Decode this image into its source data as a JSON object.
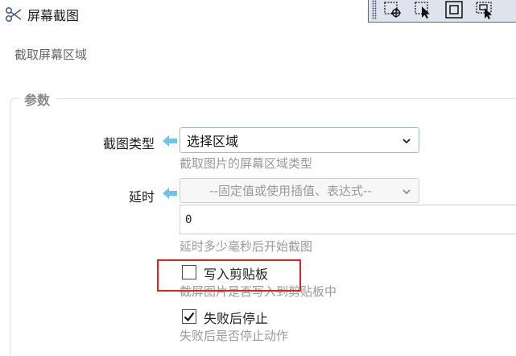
{
  "title": {
    "text": "屏幕截图",
    "icon": "scissors-icon"
  },
  "toolbar": {
    "buttons": [
      {
        "icon": "capture-region-icon"
      },
      {
        "icon": "select-pointer-icon"
      },
      {
        "icon": "capture-window-icon"
      },
      {
        "icon": "capture-element-icon"
      }
    ]
  },
  "subtitle": "截取屏幕区域",
  "section": {
    "title": "参数"
  },
  "params": {
    "capture_type": {
      "label": "截图类型",
      "value": "选择区域",
      "hint": "截取图片的屏幕区域类型"
    },
    "delay": {
      "label": "延时",
      "placeholder": "--固定值或使用插值、表达式--",
      "value": "0",
      "hint": "延时多少毫秒后开始截图"
    },
    "write_clipboard": {
      "label": "写入剪贴板",
      "checked": false,
      "hint": "截屏图片是否写入到剪贴板中"
    },
    "stop_on_fail": {
      "label": "失败后停止",
      "checked": true,
      "hint": "失败后是否停止动作"
    }
  },
  "colors": {
    "arrow": "#6ec4ee",
    "highlight": "#e02424",
    "select_border": "#9fb8d6"
  }
}
